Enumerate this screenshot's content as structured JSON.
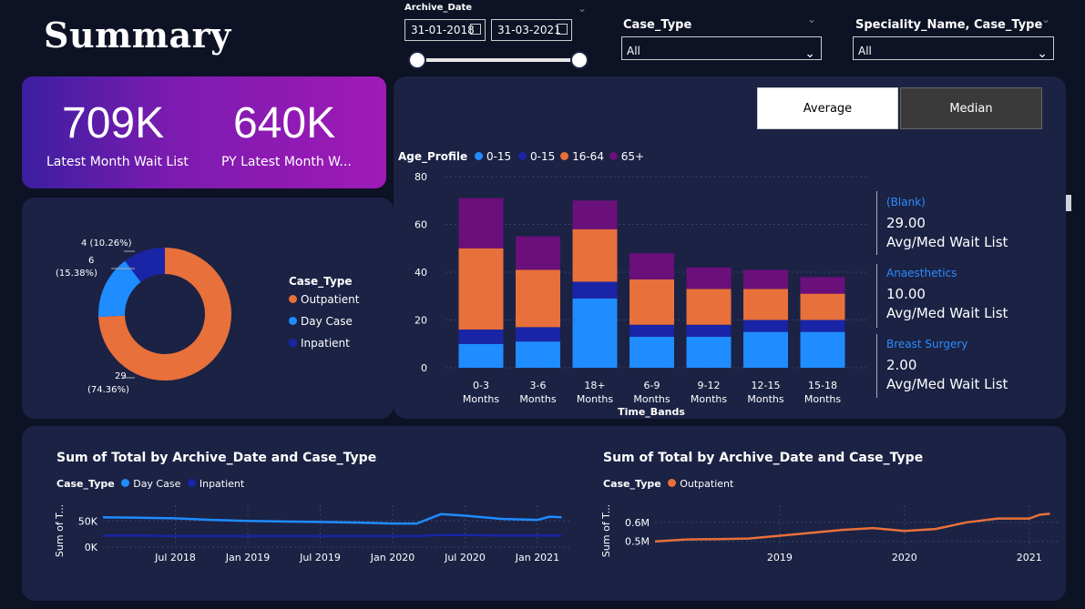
{
  "page": {
    "title": "Summary"
  },
  "slicers": {
    "archive_date": {
      "label": "Archive_Date",
      "start": "31-01-2018",
      "end": "31-03-2021"
    },
    "case_type": {
      "label": "Case_Type",
      "value": "All"
    },
    "speciality": {
      "label": "Speciality_Name, Case_Type",
      "value": "All"
    }
  },
  "kpis": {
    "latest": {
      "value": "709K",
      "label": "Latest Month Wait List"
    },
    "py_latest": {
      "value": "640K",
      "label": "PY Latest Month W..."
    }
  },
  "toggle": {
    "average": "Average",
    "median": "Median"
  },
  "donut": {
    "legend_title": "Case_Type",
    "legend_items": [
      {
        "label": "Outpatient",
        "color": "#e8703a"
      },
      {
        "label": "Day Case",
        "color": "#1f8cff"
      },
      {
        "label": "Inpatient",
        "color": "#1a24a6"
      }
    ],
    "labels": {
      "inpatient": "4 (10.26%)",
      "daycase_value": "6",
      "daycase_pct": "(15.38%)",
      "outpatient_value": "29",
      "outpatient_pct": "(74.36%)"
    }
  },
  "bar_chart": {
    "legend_title": "Age_Profile",
    "legend_items": [
      {
        "label": "0-15",
        "color": "#1f8cff"
      },
      {
        "label": "0-15",
        "color": "#1a24a6"
      },
      {
        "label": "16-64",
        "color": "#e8703a"
      },
      {
        "label": "65+",
        "color": "#6b0f7a"
      }
    ],
    "xlabel": "Time_Bands",
    "yticks": [
      "0",
      "20",
      "40",
      "60",
      "80"
    ],
    "categories": [
      [
        "0-3",
        "Months"
      ],
      [
        "3-6",
        "Months"
      ],
      [
        "18+",
        "Months"
      ],
      [
        "6-9",
        "Months"
      ],
      [
        "9-12",
        "Months"
      ],
      [
        "12-15",
        "Months"
      ],
      [
        "15-18",
        "Months"
      ]
    ]
  },
  "cards": [
    {
      "head": "(Blank)",
      "value": "29.00",
      "label": "Avg/Med Wait List"
    },
    {
      "head": "Anaesthetics",
      "value": "10.00",
      "label": "Avg/Med Wait List"
    },
    {
      "head": "Breast Surgery",
      "value": "2.00",
      "label": "Avg/Med Wait List"
    }
  ],
  "line_left": {
    "title": "Sum of Total by Archive_Date and Case_Type",
    "legend_title": "Case_Type",
    "legend_items": [
      {
        "label": "Day Case",
        "color": "#1f8cff"
      },
      {
        "label": "Inpatient",
        "color": "#1a24a6"
      }
    ],
    "ylabel": "Sum of T...",
    "yticks": [
      "50K",
      "0K"
    ],
    "xticks": [
      "Jul 2018",
      "Jan 2019",
      "Jul 2019",
      "Jan 2020",
      "Jul 2020",
      "Jan 2021"
    ]
  },
  "line_right": {
    "title": "Sum of Total by Archive_Date and Case_Type",
    "legend_title": "Case_Type",
    "legend_items": [
      {
        "label": "Outpatient",
        "color": "#e8703a"
      }
    ],
    "ylabel": "Sum of T...",
    "yticks": [
      "0.6M",
      "0.5M"
    ],
    "xticks": [
      "2019",
      "2020",
      "2021"
    ]
  },
  "chart_data": [
    {
      "type": "pie",
      "categories": [
        "Outpatient",
        "Day Case",
        "Inpatient"
      ],
      "values": [
        29,
        6,
        4
      ],
      "legend": "right"
    },
    {
      "type": "bar",
      "stacked": true,
      "categories": [
        "0-3 Months",
        "3-6 Months",
        "18+ Months",
        "6-9 Months",
        "9-12 Months",
        "12-15 Months",
        "15-18 Months"
      ],
      "series": [
        {
          "name": "0-15",
          "color": "#1f8cff",
          "values": [
            10,
            11,
            29,
            13,
            13,
            15,
            15
          ]
        },
        {
          "name": "0-15",
          "color": "#1a24a6",
          "values": [
            6,
            6,
            7,
            5,
            5,
            5,
            5
          ]
        },
        {
          "name": "16-64",
          "color": "#e8703a",
          "values": [
            34,
            24,
            22,
            19,
            15,
            13,
            11
          ]
        },
        {
          "name": "65+",
          "color": "#6b0f7a",
          "values": [
            21,
            14,
            12,
            11,
            9,
            8,
            7
          ]
        }
      ],
      "xlabel": "Time_Bands",
      "ylim": [
        0,
        80
      ],
      "grid": true,
      "legend": "top-left"
    },
    {
      "type": "line",
      "x": [
        "2018-01",
        "2018-04",
        "2018-07",
        "2018-10",
        "2019-01",
        "2019-04",
        "2019-07",
        "2019-10",
        "2020-01",
        "2020-03",
        "2020-05",
        "2020-07",
        "2020-10",
        "2021-01",
        "2021-02",
        "2021-03"
      ],
      "series": [
        {
          "name": "Day Case",
          "color": "#1f8cff",
          "values": [
            57000,
            56000,
            55000,
            52000,
            50000,
            49000,
            48000,
            47000,
            45000,
            45000,
            63000,
            60000,
            54000,
            52000,
            58000,
            57000
          ]
        },
        {
          "name": "Inpatient",
          "color": "#1a24a6",
          "values": [
            22000,
            22000,
            21000,
            21000,
            21000,
            21000,
            21000,
            21000,
            21000,
            21000,
            23000,
            23000,
            22000,
            22000,
            22000,
            22000
          ]
        }
      ],
      "yticks": [
        "0K",
        "50K"
      ],
      "grid": true,
      "legend": "top-left"
    },
    {
      "type": "line",
      "x": [
        "2018-01",
        "2018-04",
        "2018-07",
        "2018-10",
        "2019-01",
        "2019-04",
        "2019-07",
        "2019-10",
        "2020-01",
        "2020-04",
        "2020-07",
        "2020-10",
        "2021-01",
        "2021-02",
        "2021-03"
      ],
      "series": [
        {
          "name": "Outpatient",
          "color": "#e8703a",
          "values": [
            500000,
            510000,
            512000,
            515000,
            530000,
            545000,
            560000,
            570000,
            555000,
            565000,
            600000,
            620000,
            620000,
            640000,
            645000
          ]
        }
      ],
      "yticks": [
        "0.5M",
        "0.6M"
      ],
      "grid": true,
      "legend": "top-left"
    }
  ]
}
